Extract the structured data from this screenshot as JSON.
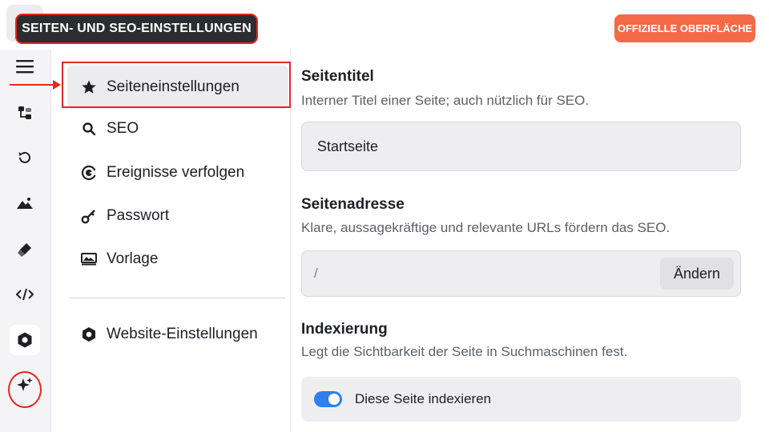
{
  "header": {
    "title": "SEITEN- UND SEO-EINSTELLUNGEN",
    "official_button": "OFFIZIELLE OBERFLÄCHE"
  },
  "rail": {
    "icons": [
      "menu-icon",
      "pages-tree-icon",
      "history-icon",
      "image-icon",
      "brush-icon",
      "code-icon",
      "settings-hexagon-icon",
      "sparkle-icon"
    ],
    "active": "settings-hexagon-icon"
  },
  "sidebar": {
    "items": [
      {
        "label": "Seiteneinstellungen",
        "icon": "star-icon",
        "selected": true
      },
      {
        "label": "SEO",
        "icon": "search-icon"
      },
      {
        "label": "Ereignisse verfolgen",
        "icon": "target-icon"
      },
      {
        "label": "Passwort",
        "icon": "key-icon"
      },
      {
        "label": "Vorlage",
        "icon": "template-icon"
      }
    ],
    "footer_item": {
      "label": "Website-Einstellungen",
      "icon": "hexagon-settings-icon"
    }
  },
  "main": {
    "page_title": {
      "heading": "Seitentitel",
      "description": "Interner Titel einer Seite; auch nützlich für SEO.",
      "value": "Startseite"
    },
    "page_address": {
      "heading": "Seitenadresse",
      "description": "Klare, aussagekräftige und relevante URLs fördern das SEO.",
      "value": "/",
      "change_button": "Ändern"
    },
    "indexing": {
      "heading": "Indexierung",
      "description": "Legt die Sichtbarkeit der Seite in Suchmaschinen fest.",
      "toggle_label": "Diese Seite indexieren",
      "toggle_on": true
    }
  },
  "colors": {
    "accent": "#f46a47",
    "highlight": "#e5271f",
    "toggle": "#2f7ff0",
    "title_badge": "#2c2d31"
  }
}
